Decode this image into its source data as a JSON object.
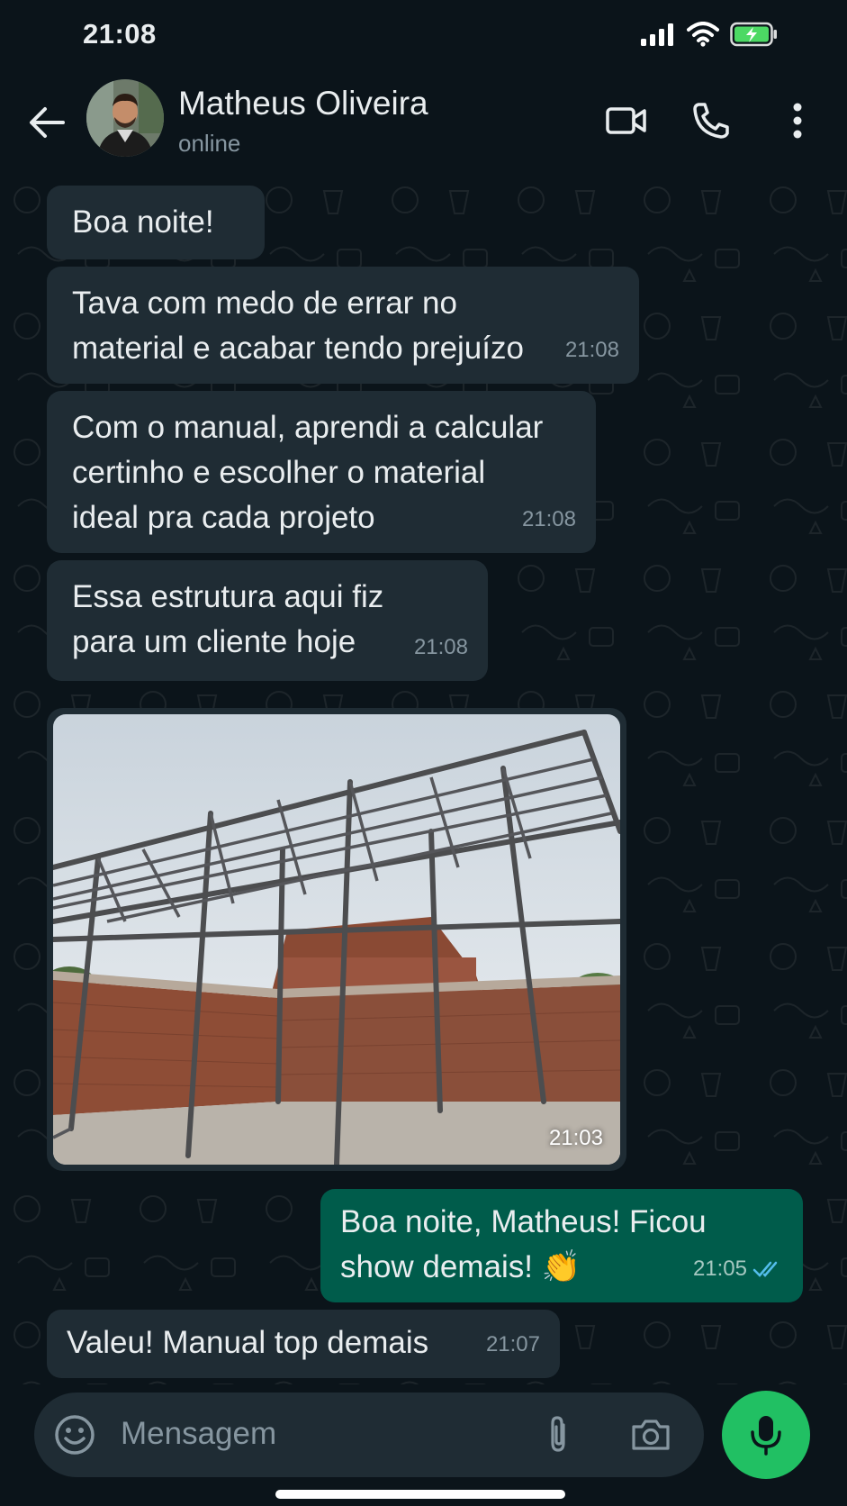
{
  "status_bar": {
    "time": "21:08"
  },
  "header": {
    "contact_name": "Matheus Oliveira",
    "contact_status": "online"
  },
  "messages": [
    {
      "direction": "in",
      "text": "Boa noite!",
      "time": ""
    },
    {
      "direction": "in",
      "text": "Tava com medo de errar no\nmaterial e acabar tendo prejuízo",
      "time": "21:08"
    },
    {
      "direction": "in",
      "text": "Com o manual, aprendi a calcular\ncertinho e escolher o material\nideal pra cada projeto",
      "time": "21:08"
    },
    {
      "direction": "in",
      "text": "Essa estrutura aqui fiz\npara um cliente hoje",
      "time": "21:08"
    },
    {
      "direction": "in",
      "type": "image",
      "time": "21:03"
    },
    {
      "direction": "out",
      "text": "Boa noite, Matheus! Ficou\nshow demais! 👏",
      "time": "21:05",
      "read": true
    },
    {
      "direction": "in",
      "text": "Valeu! Manual top demais",
      "time": "21:07"
    }
  ],
  "input": {
    "placeholder": "Mensagem"
  },
  "colors": {
    "background": "#0b141a",
    "incoming_bubble": "#1f2c34",
    "outgoing_bubble": "#005c4b",
    "accent_green": "#21c063",
    "read_ticks": "#53bdeb"
  },
  "icons": [
    "signal-icon",
    "wifi-icon",
    "battery-icon",
    "back-arrow-icon",
    "video-call-icon",
    "phone-icon",
    "more-options-icon",
    "emoji-icon",
    "attach-icon",
    "camera-icon",
    "mic-icon",
    "double-check-icon"
  ]
}
